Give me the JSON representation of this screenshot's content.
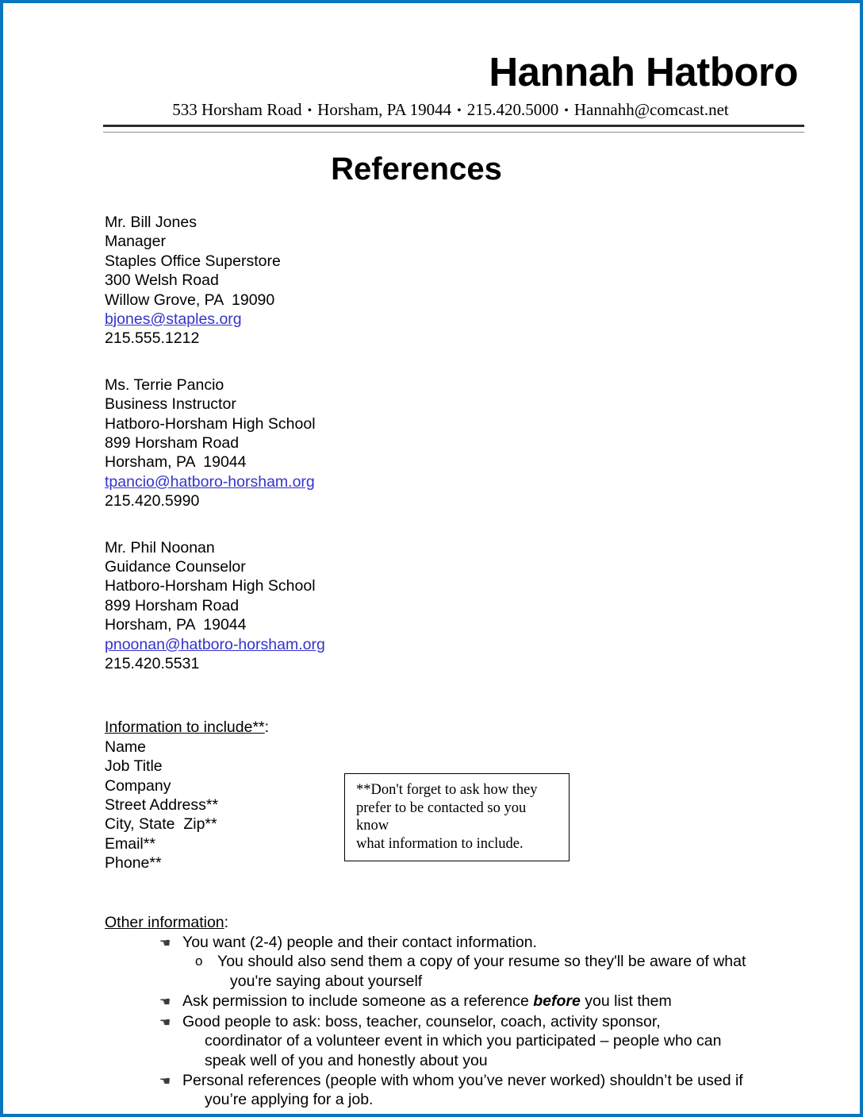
{
  "page": {
    "border_color": "#0b76bd",
    "background": "#ffffff",
    "link_color": "#3333cc"
  },
  "letterhead": {
    "name": "Hannah Hatboro",
    "contact": {
      "street": "533 Horsham Road",
      "city_state_zip": "Horsham, PA  19044",
      "phone": "215.420.5000",
      "email": "Hannahh@comcast.net",
      "separator": "•"
    }
  },
  "title": "References",
  "references": [
    {
      "name": "Mr. Bill Jones",
      "job_title": "Manager",
      "company": "Staples Office Superstore",
      "street": "300 Welsh Road",
      "city_state_zip": "Willow Grove, PA  19090",
      "email": "bjones@staples.org",
      "phone": "215.555.1212"
    },
    {
      "name": "Ms. Terrie Pancio",
      "job_title": "Business Instructor",
      "company": "Hatboro-Horsham High School",
      "street": "899 Horsham Road",
      "city_state_zip": "Horsham, PA  19044",
      "email": "tpancio@hatboro-horsham.org",
      "phone": "215.420.5990"
    },
    {
      "name": "Mr. Phil Noonan",
      "job_title": "Guidance Counselor",
      "company": "Hatboro-Horsham High School",
      "street": "899 Horsham Road",
      "city_state_zip": "Horsham, PA  19044",
      "email": "pnoonan@hatboro-horsham.org",
      "phone": "215.420.5531"
    }
  ],
  "include_section": {
    "heading_underlined": "Information to include**",
    "heading_suffix": ":",
    "items": [
      "Name",
      "Job Title",
      "Company",
      "Street Address**",
      "City, State  Zip**",
      "Email**",
      "Phone**"
    ]
  },
  "note_box": {
    "line1": "**Don't forget to ask how they",
    "line2": "prefer to be contacted so you know",
    "line3": "what information to include."
  },
  "other_section": {
    "heading_underlined": "Other information",
    "heading_suffix": ":",
    "bullet_glyph": "☚",
    "subbullet_glyph": "o",
    "bullets": [
      {
        "text": "You want (2-4) people and their contact information.",
        "sub": [
          {
            "line1": "You should also send them a copy of your resume so they'll be aware of what",
            "line2": "you're saying about yourself"
          }
        ]
      },
      {
        "text_before": "Ask permission to include someone as a reference ",
        "emphasis": "before",
        "text_after": " you list them"
      },
      {
        "line1": "Good people to ask: boss, teacher, counselor, coach, activity sponsor,",
        "line2": "coordinator of a volunteer event in which you participated – people who can",
        "line3": "speak well of you and honestly about you"
      },
      {
        "line1": "Personal references (people with whom you’ve never worked) shouldn’t be used if",
        "line2": "you’re applying for a job."
      }
    ]
  }
}
